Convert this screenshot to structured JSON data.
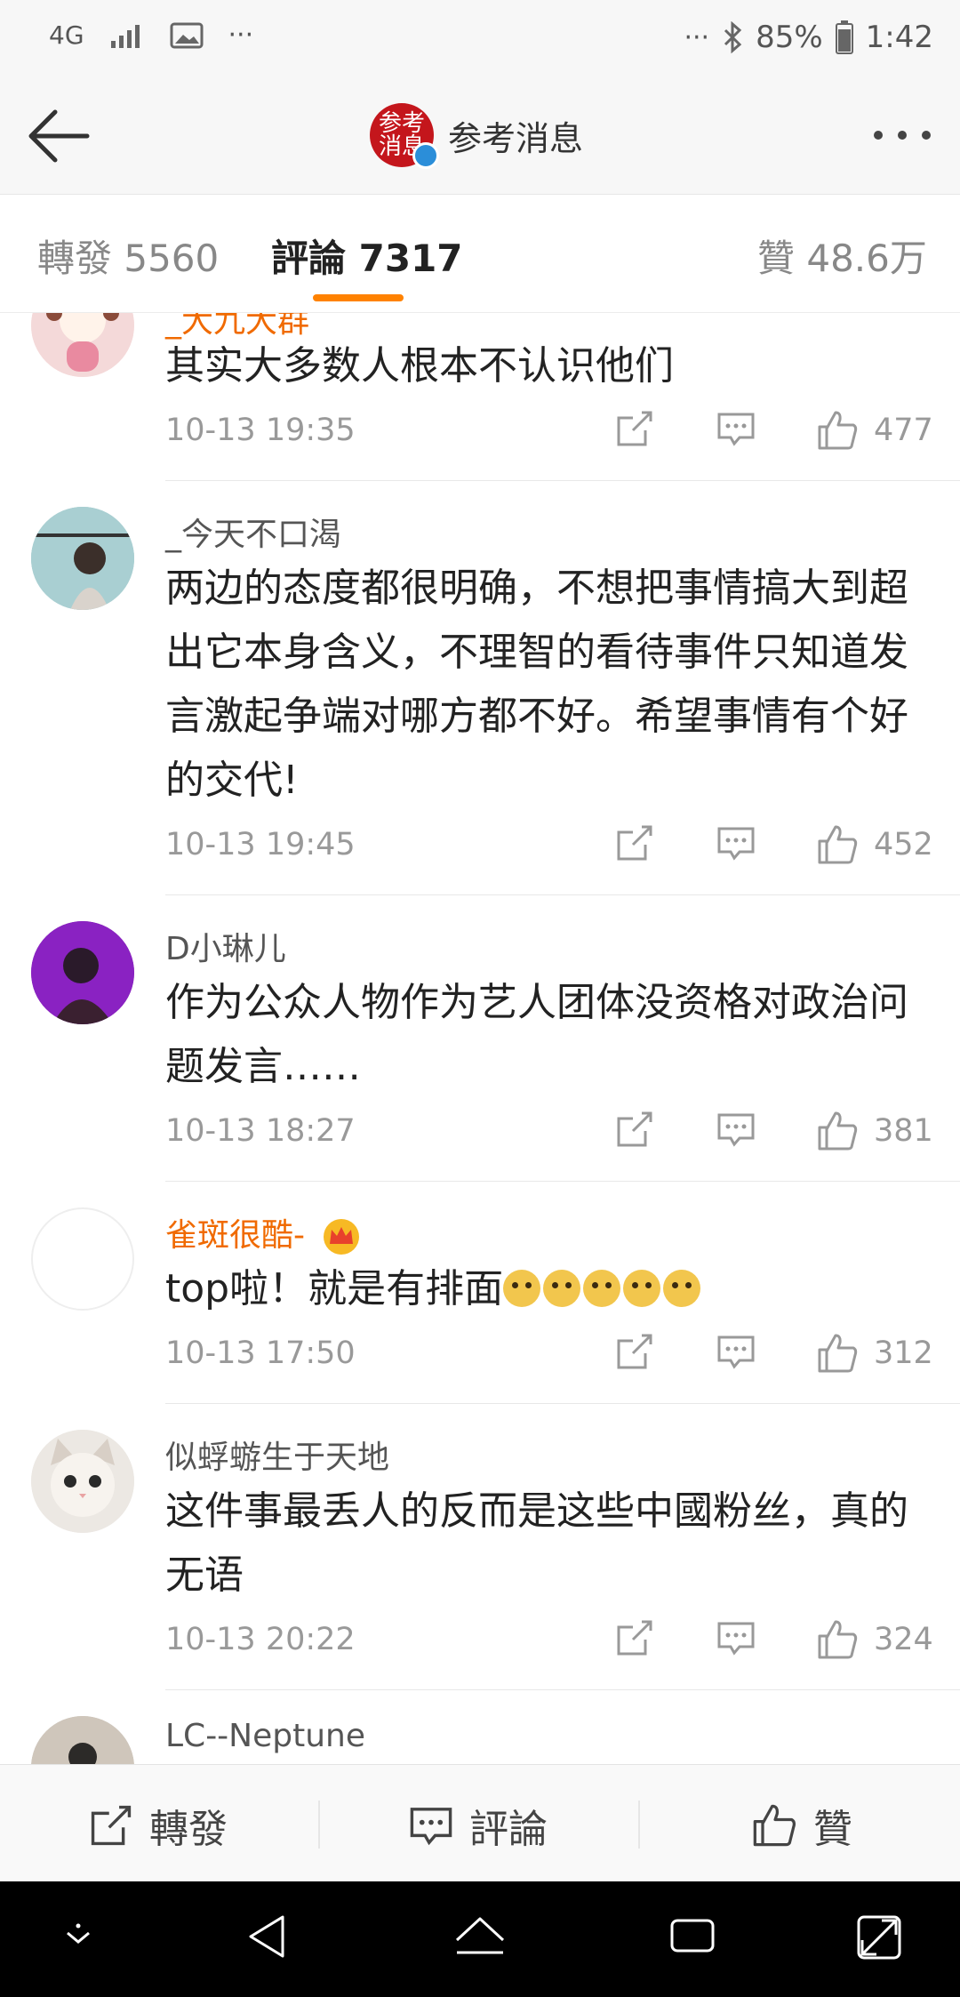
{
  "status": {
    "network": "4G",
    "battery": "85%",
    "time": "1:42"
  },
  "header": {
    "title": "参考消息",
    "logo_text": "参考消息"
  },
  "tabs": [
    {
      "label": "轉發 5560"
    },
    {
      "label": "評論 7317"
    },
    {
      "label": "贊 48.6万"
    }
  ],
  "comments": [
    {
      "user": "_大九大群",
      "text": "其实大多数人根本不认识他们",
      "time": "10-13 19:35",
      "likes": "477"
    },
    {
      "user": "_今天不口渴",
      "text": "两边的态度都很明确，不想把事情搞大到超出它本身含义，不理智的看待事件只知道发言激起争端对哪方都不好。希望事情有个好的交代!",
      "time": "10-13 19:45",
      "likes": "452"
    },
    {
      "user": "D小琳儿",
      "text": "作为公众人物作为艺人团体没资格对政治问题发言……",
      "time": "10-13 18:27",
      "likes": "381"
    },
    {
      "user": "雀斑很酷-",
      "text": "top啦！就是有排面",
      "time": "10-13 17:50",
      "likes": "312"
    },
    {
      "user": "似蜉蝣生于天地",
      "text": "这件事最丢人的反而是这些中國粉丝，真的无语",
      "time": "10-13 20:22",
      "likes": "324"
    },
    {
      "user": "LC--Neptune"
    }
  ],
  "bottom_bar": {
    "repost": "轉發",
    "comment": "評論",
    "like": "贊"
  },
  "colors": {
    "accent": "#ff8200",
    "vip_name": "#f06a00",
    "brand": "#c4161c"
  }
}
